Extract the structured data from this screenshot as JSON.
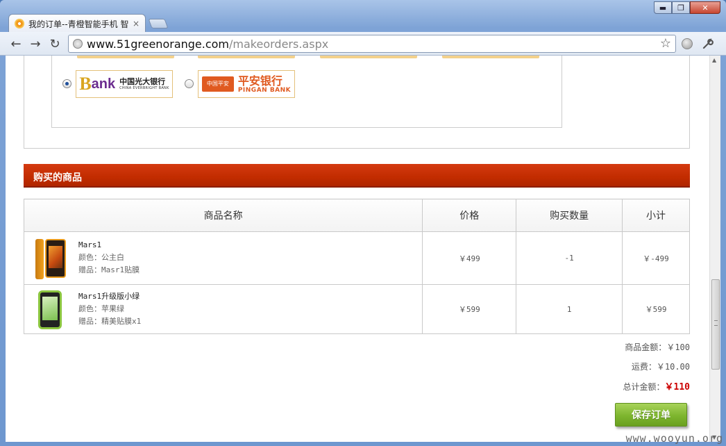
{
  "browser": {
    "tab_title": "我的订单--青橙智能手机 智",
    "tab_close": "×",
    "url_host": "www.51greenorange.com",
    "url_path": "/makeorders.aspx",
    "window_buttons": {
      "minimize": "▬",
      "maximize": "❐",
      "close": "✕"
    },
    "nav": {
      "back": "←",
      "forward": "→",
      "reload": "↻"
    },
    "star": "☆",
    "wrench": "🔧"
  },
  "payment": {
    "banks": [
      {
        "id": "ceb",
        "selected": true,
        "logo_letter": "B",
        "logo_suffix": "ank",
        "name_cn": "中国光大银行",
        "name_en": "CHINA EVERBRIGHT BANK"
      },
      {
        "id": "pingan",
        "selected": false,
        "mark": "中国平安",
        "name_cn": "平安银行",
        "name_en": "PINGAN BANK"
      }
    ]
  },
  "section": {
    "title": "购买的商品"
  },
  "table": {
    "headers": [
      "商品名称",
      "价格",
      "购买数量",
      "小计"
    ],
    "rows": [
      {
        "name": "Mars1",
        "color": "颜色：公主白",
        "gift": "赠品：Masr1贴膜",
        "price": "￥499",
        "qty": "-1",
        "subtotal": "￥-499"
      },
      {
        "name": "Mars1升级版小绿",
        "color": "颜色：苹果绿",
        "gift": "赠品：精美贴膜x1",
        "price": "￥599",
        "qty": "1",
        "subtotal": "￥599"
      }
    ]
  },
  "summary": {
    "goods_label": "商品金额：",
    "goods_value": "￥100",
    "shipping_label": "运费：",
    "shipping_value": "￥10.00",
    "total_label": "总计金额：",
    "total_value": "￥110"
  },
  "actions": {
    "save_label": "保存订单"
  },
  "watermark": "www.wooyun.org",
  "colors": {
    "section_bar": "#c22c00",
    "save_button": "#7db52e",
    "total": "#cc0000"
  }
}
